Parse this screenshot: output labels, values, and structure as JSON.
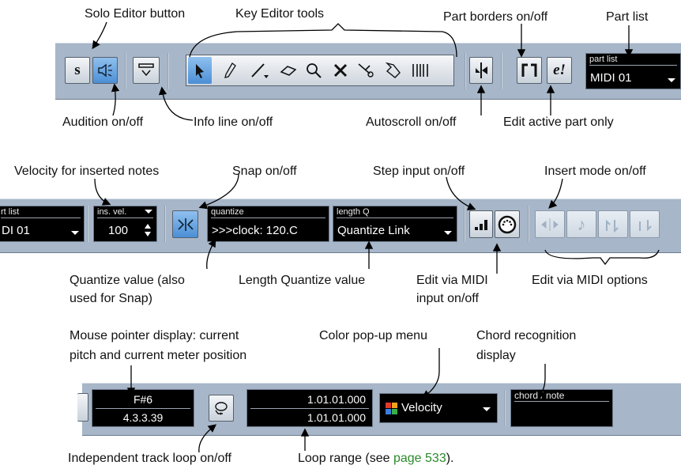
{
  "top_labels": {
    "solo_editor": "Solo Editor button",
    "key_editor_tools": "Key Editor tools",
    "part_borders": "Part borders on/off",
    "part_list": "Part list",
    "audition": "Audition on/off",
    "info_line": "Info line on/off",
    "autoscroll": "Autoscroll on/off",
    "edit_active": "Edit active part only"
  },
  "toolbar1": {
    "part_list_label": "part list",
    "part_list_value": "MIDI 01",
    "solo_glyph": "s",
    "edit_active_glyph": "e!"
  },
  "mid_labels": {
    "velocity": "Velocity for inserted notes",
    "snap": "Snap on/off",
    "step_input": "Step input on/off",
    "insert_mode": "Insert mode on/off",
    "quantize_1": "Quantize value (also",
    "quantize_2": "used for Snap)",
    "length_q": "Length Quantize value",
    "edit_midi_1": "Edit via MIDI",
    "edit_midi_2": "input on/off",
    "edit_midi_options": "Edit via MIDI options"
  },
  "toolbar2": {
    "part_list_label": "rt list",
    "part_list_value": "DI 01",
    "ins_vel_label": "ins. vel.",
    "ins_vel_value": "100",
    "quantize_label": "quantize",
    "quantize_value": ">>>clock: 120.C",
    "length_label": "length Q",
    "length_value": "Quantize Link"
  },
  "bot_labels": {
    "mouse_1": "Mouse pointer display: current",
    "mouse_2": "pitch and current meter position",
    "color_menu": "Color pop-up menu",
    "chord_1": "Chord recognition",
    "chord_2": "display",
    "loop_toggle": "Independent track loop on/off",
    "loop_range_prefix": "Loop range (see ",
    "loop_range_link": "page 533",
    "loop_range_suffix": ")."
  },
  "toolbar3": {
    "pitch": "F#6",
    "position": "4.3.3.39",
    "loop_start": "1.01.01.000",
    "loop_end": "1.01.01.000",
    "color_value": "Velocity",
    "chord_label": "chord / note"
  },
  "colors": {
    "toolbar_bg": "#a7b6c8",
    "button_on": "#4c8fd6",
    "link": "#2a8a2a"
  }
}
